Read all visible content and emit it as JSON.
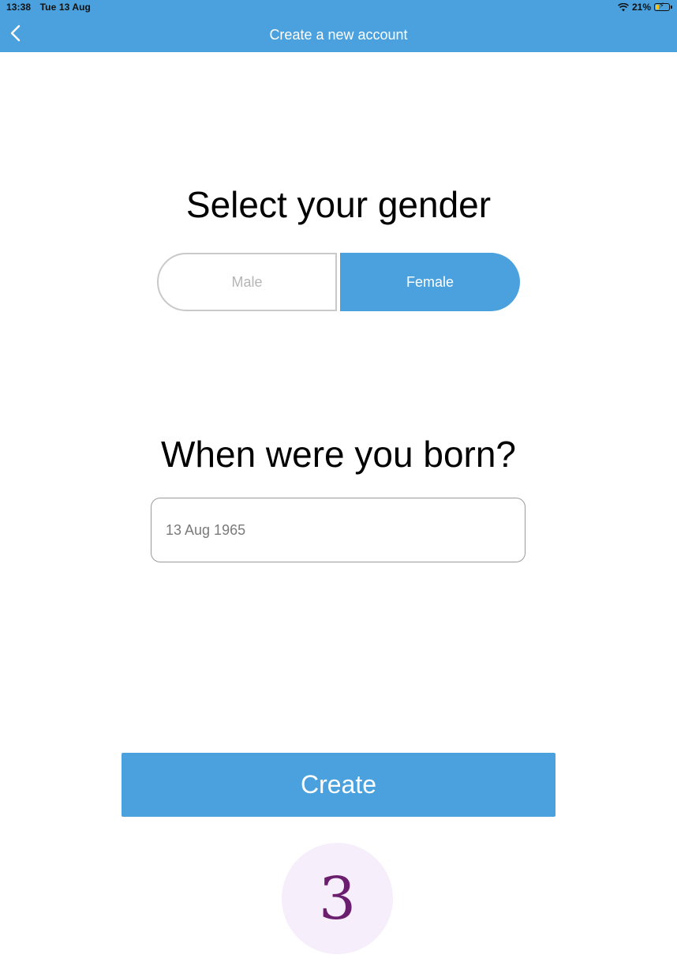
{
  "status_bar": {
    "time": "13:38",
    "date": "Tue 13 Aug",
    "wifi_icon": "wifi-icon",
    "battery_percent": "21%",
    "battery_icon": "battery-charging-icon"
  },
  "nav": {
    "back_icon": "chevron-left-icon",
    "title": "Create a new account"
  },
  "gender": {
    "heading": "Select your gender",
    "options": [
      "Male",
      "Female"
    ],
    "selected": "Female"
  },
  "birth": {
    "heading": "When were you born?",
    "value": "13 Aug 1965"
  },
  "create_button": {
    "label": "Create"
  },
  "step_indicator": {
    "label": "3"
  },
  "colors": {
    "accent": "#4aa1dd",
    "step_bg": "#f6eefb",
    "step_text": "#6b1e6e"
  }
}
